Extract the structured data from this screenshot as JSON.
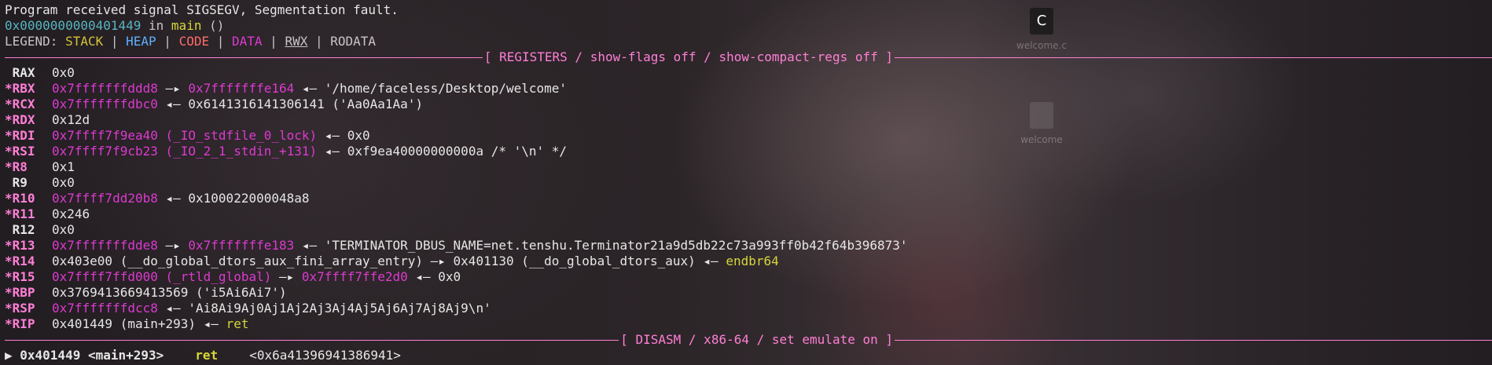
{
  "signal_line": "Program received signal SIGSEGV, Segmentation fault.",
  "frame_line": {
    "addr": "0x0000000000401449",
    "text": " in ",
    "func": "main",
    "args": " ()"
  },
  "legend": {
    "prefix": "LEGEND: ",
    "stack": "STACK",
    "heap": "HEAP",
    "code": "CODE",
    "data": "DATA",
    "rwx": "RWX",
    "rodata": "RODATA",
    "sep": " | "
  },
  "registers_header": "[ REGISTERS / show-flags off / show-compact-regs off ]",
  "registers": [
    {
      "mark": " ",
      "name": "RAX",
      "value": "0x0",
      "rest": ""
    },
    {
      "mark": "*",
      "name": "RBX",
      "value": "0x7fffffffddd8",
      "arrow": " —▸ ",
      "value2": "0x7fffffffe164",
      "rest": " ◂— '/home/faceless/Desktop/welcome'"
    },
    {
      "mark": "*",
      "name": "RCX",
      "value": "0x7fffffffdbc0",
      "rest": " ◂— 0x6141316141306141 ('Aa0Aa1Aa')"
    },
    {
      "mark": "*",
      "name": "RDX",
      "value": "0x12d",
      "rest": ""
    },
    {
      "mark": "*",
      "name": "RDI",
      "value": "0x7ffff7f9ea40",
      "sym": " (_IO_stdfile_0_lock)",
      "rest": " ◂— 0x0"
    },
    {
      "mark": "*",
      "name": "RSI",
      "value": "0x7ffff7f9cb23",
      "sym": " (_IO_2_1_stdin_+131)",
      "rest": " ◂— 0xf9ea40000000000a /* '\\n' */"
    },
    {
      "mark": "*",
      "name": "R8",
      "value": "0x1",
      "rest": ""
    },
    {
      "mark": " ",
      "name": "R9",
      "value": "0x0",
      "rest": ""
    },
    {
      "mark": "*",
      "name": "R10",
      "value": "0x7ffff7dd20b8",
      "rest": " ◂— 0x100022000048a8"
    },
    {
      "mark": "*",
      "name": "R11",
      "value": "0x246",
      "rest": ""
    },
    {
      "mark": " ",
      "name": "R12",
      "value": "0x0",
      "rest": ""
    },
    {
      "mark": "*",
      "name": "R13",
      "value": "0x7fffffffdde8",
      "arrow": " —▸ ",
      "value2": "0x7fffffffe183",
      "rest": " ◂— 'TERMINATOR_DBUS_NAME=net.tenshu.Terminator21a9d5db22c73a993ff0b42f64b396873'"
    },
    {
      "mark": "*",
      "name": "R14",
      "value": "0x403e00 (__do_global_dtors_aux_fini_array_entry) —▸ 0x401130 (__do_global_dtors_aux) ◂— ",
      "code": "endbr64",
      "rest": ""
    },
    {
      "mark": "*",
      "name": "R15",
      "value": "0x7ffff7ffd000",
      "sym": " (_rtld_global)",
      "arrow": " —▸ ",
      "value2": "0x7ffff7ffe2d0",
      "rest": " ◂— 0x0"
    },
    {
      "mark": "*",
      "name": "RBP",
      "value": "0x3769413669413569 ('i5Ai6Ai7')",
      "rest": ""
    },
    {
      "mark": "*",
      "name": "RSP",
      "value": "0x7fffffffdcc8",
      "rest": " ◂— 'Ai8Ai9Aj0Aj1Aj2Aj3Aj4Aj5Aj6Aj7Aj8Aj9\\n'"
    },
    {
      "mark": "*",
      "name": "RIP",
      "value": "0x401449 (main+293)",
      "rest": " ◂— ",
      "code": "ret"
    }
  ],
  "disasm_header": "[ DISASM / x86-64 / set emulate on ]",
  "disasm_line": {
    "marker": "▶ ",
    "addr": "0x401449 <main+293>",
    "instr": "ret",
    "operand": "<0x6a41396941386941>"
  },
  "desktop_icons": [
    {
      "glyph": "C",
      "label": "welcome.c"
    },
    {
      "label": "welcome"
    }
  ]
}
